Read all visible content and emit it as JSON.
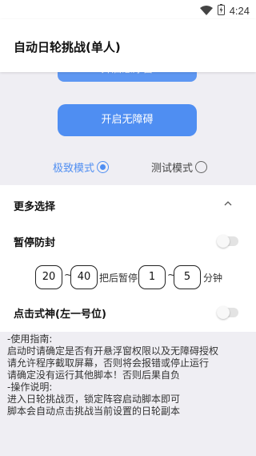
{
  "status_bar": {
    "time": "4:24",
    "icons": [
      "wifi-icon",
      "battery-charging-icon"
    ]
  },
  "app_bar": {
    "title": "自动日轮挑战(单人)"
  },
  "buttons": {
    "hidden_label": "开启悬浮窗",
    "accessibility_label": "开启无障碍"
  },
  "modes": {
    "options": [
      {
        "label": "极致模式",
        "selected": true
      },
      {
        "label": "测试模式",
        "selected": false
      }
    ]
  },
  "more": {
    "title": "更多选择",
    "pause_label": "暂停防封",
    "pause_enabled": false,
    "pause_values": {
      "min_a": "20",
      "min_b": "40",
      "text_mid": "把后暂停",
      "pause_a": "1",
      "pause_b": "5",
      "text_unit": "分钟",
      "tilde": "~"
    },
    "click_label": "点击式神(左一号位)",
    "click_enabled": false
  },
  "instructions": [
    "-使用指南:",
    "启动时请确定是否有开悬浮窗权限以及无障碍授权",
    "请允许程序截取屏幕，否则将会报错或停止运行",
    "请确定没有运行其他脚本！否则后果自负",
    "-操作说明:",
    "进入日轮挑战页，锁定阵容启动脚本即可",
    "脚本会自动点击挑战当前设置的日轮副本"
  ],
  "colors": {
    "accent": "#4f8ef2",
    "background": "#efeef3",
    "card": "#ffffff"
  }
}
